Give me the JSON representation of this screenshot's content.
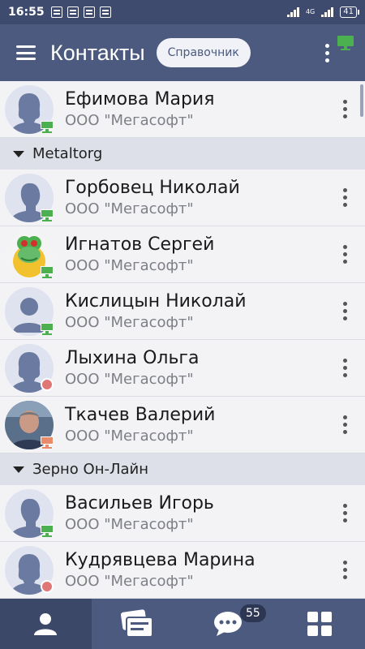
{
  "status_bar": {
    "time": "16:55",
    "network": "4G",
    "battery": "41"
  },
  "header": {
    "title": "Контакты",
    "directory_button": "Справочник"
  },
  "contacts_top": [
    {
      "name": "Ефимова Мария",
      "org": "ООО \"Мегасофт\"",
      "avatar": "female",
      "status": "online-desktop"
    }
  ],
  "groups": [
    {
      "title": "Metaltorg",
      "contacts": [
        {
          "name": "Горбовец Николай",
          "org": "ООО \"Мегасофт\"",
          "avatar": "male",
          "status": "online-desktop"
        },
        {
          "name": "Игнатов Сергей",
          "org": "ООО \"Мегасофт\"",
          "avatar": "frog-photo",
          "status": "online-desktop"
        },
        {
          "name": "Кислицын Николай",
          "org": "ООО \"Мегасофт\"",
          "avatar": "generic",
          "status": "online-desktop"
        },
        {
          "name": "Лыхина Ольга",
          "org": "ООО \"Мегасофт\"",
          "avatar": "female",
          "status": "offline"
        },
        {
          "name": "Ткачев Валерий",
          "org": "ООО \"Мегасофт\"",
          "avatar": "photo",
          "status": "away"
        }
      ]
    },
    {
      "title": "Зерно Он-Лайн",
      "contacts": [
        {
          "name": "Васильев Игорь",
          "org": "ООО \"Мегасофт\"",
          "avatar": "male",
          "status": "online-desktop"
        },
        {
          "name": "Кудрявцева Марина",
          "org": "ООО \"Мегасофт\"",
          "avatar": "female",
          "status": "offline"
        }
      ]
    }
  ],
  "bottom_nav": {
    "unread_count": "55",
    "tabs": [
      "contacts-icon",
      "news-icon",
      "chat-icon",
      "apps-icon"
    ]
  },
  "colors": {
    "header": "#4b5a7e",
    "status_online": "#4caf50",
    "status_offline": "#e07777",
    "group_bg": "#dde0e8"
  }
}
